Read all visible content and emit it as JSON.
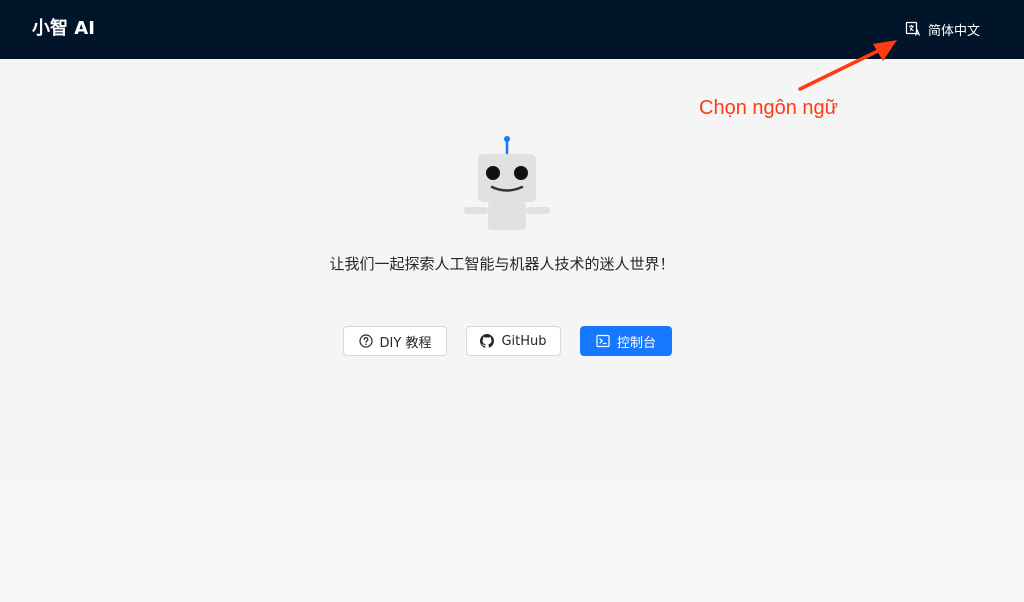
{
  "header": {
    "logo": "小智 AI",
    "language_label": "简体中文",
    "language_icon": "translate-icon",
    "background": "#001529"
  },
  "annotation": {
    "text": "Chọn ngôn ngữ",
    "color": "#ff3b14"
  },
  "main": {
    "tagline": "让我们一起探索人工智能与机器人技术的迷人世界！",
    "buttons": [
      {
        "label": "DIY 教程",
        "icon": "question-circle-icon",
        "style": "default"
      },
      {
        "label": "GitHub",
        "icon": "github-icon",
        "style": "default"
      },
      {
        "label": "控制台",
        "icon": "console-icon",
        "style": "primary"
      }
    ]
  },
  "colors": {
    "primary": "#1677ff",
    "page_background": "#f5f5f5"
  }
}
